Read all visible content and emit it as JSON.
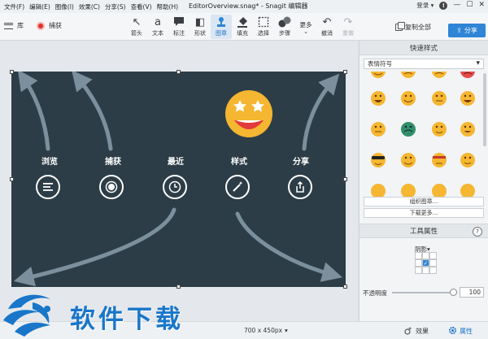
{
  "menu": [
    "文件(F)",
    "编辑(E)",
    "图像(I)",
    "效果(C)",
    "分享(S)",
    "查看(V)",
    "帮助(H)"
  ],
  "document_title": "EditorOverview.snag* - Snagit 编辑器",
  "account": {
    "login_label": "登录",
    "login_arrow": "▾"
  },
  "left_toolbar": {
    "library_label": "库",
    "capture_label": "捕获"
  },
  "tools": [
    {
      "label": "箭头",
      "icon": "arrow-icon",
      "glyph": "↖"
    },
    {
      "label": "文本",
      "icon": "text-icon",
      "glyph": "a"
    },
    {
      "label": "标注",
      "icon": "callout-icon",
      "glyph": "💬"
    },
    {
      "label": "形状",
      "icon": "shape-icon",
      "glyph": "◧"
    },
    {
      "label": "图章",
      "icon": "stamp-icon",
      "glyph": "⛉"
    },
    {
      "label": "填充",
      "icon": "fill-icon",
      "glyph": "◈"
    },
    {
      "label": "选择",
      "icon": "select-icon",
      "glyph": "⬚"
    },
    {
      "label": "步骤",
      "icon": "step-icon",
      "glyph": "①"
    },
    {
      "label": "更多",
      "icon": "more-icon",
      "glyph": ""
    },
    {
      "label": "撤消",
      "icon": "undo-icon",
      "glyph": "↶"
    },
    {
      "label": "重做",
      "icon": "redo-icon",
      "glyph": "↷"
    }
  ],
  "copy_all_label": "复制全部",
  "share_label": "分享",
  "canvas": {
    "items": [
      {
        "label": "浏览",
        "icon": "menu-icon"
      },
      {
        "label": "捕获",
        "icon": "record-icon"
      },
      {
        "label": "最近",
        "icon": "clock-icon"
      },
      {
        "label": "样式",
        "icon": "magic-wand-icon"
      },
      {
        "label": "分享",
        "icon": "share-icon"
      }
    ]
  },
  "panel": {
    "quick_styles_title": "快速样式",
    "category": "表情符号",
    "organize_label": "组织图章...",
    "download_label": "下载更多...",
    "tool_properties_title": "工具属性",
    "help": "?",
    "shadow_label": "阴影",
    "shadow_arrow": "▾",
    "opacity_label": "不透明度",
    "opacity_value": "100"
  },
  "status": {
    "dimensions": "700 x 450px",
    "dim_arrow": "▾",
    "effects_label": "效果",
    "properties_label": "属性"
  },
  "watermark": "软件下载",
  "colors": {
    "accent": "#2f85d6",
    "canvas_bg": "#2d3d47",
    "emoji_yellow": "#f5b631"
  }
}
